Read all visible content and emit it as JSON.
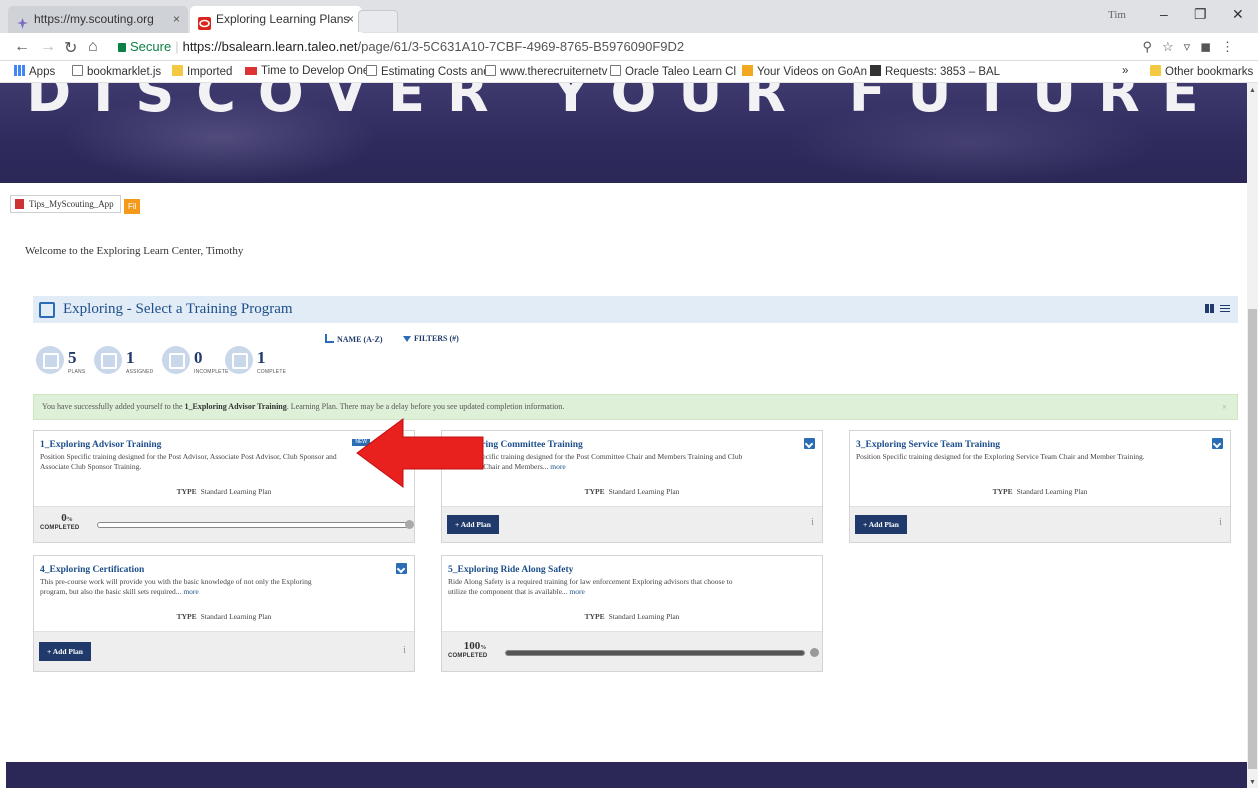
{
  "browser": {
    "tabs": [
      {
        "label": "https://my.scouting.org",
        "close": "×"
      },
      {
        "label": "Exploring Learning Plans",
        "close": "×"
      }
    ],
    "profile": "Tim",
    "url_secure": "Secure",
    "url_base": "https://bsalearn.learn.taleo.net",
    "url_path": "/page/61/3-5C631A10-7CBF-4969-8765-B5976090F9D2",
    "bookmarks": [
      "Apps",
      "bookmarklet.js",
      "Imported",
      "Time to Develop One",
      "Estimating Costs and",
      "www.therecruiternetv",
      "Oracle Taleo Learn Cl",
      "Your Videos on GoAn",
      "Requests: 3853 – BAL",
      "»",
      "Other bookmarks"
    ]
  },
  "hero": {
    "title": "DISCOVER YOUR FUTURE"
  },
  "tip_link": "Tips_MyScouting_App",
  "rss_label": "Fil",
  "welcome": "Welcome to the Exploring Learn Center, Timothy",
  "panel": {
    "title": "Exploring - Select a Training Program"
  },
  "sortbar": {
    "sort": "NAME (A-Z)",
    "filters": "FILTERS (#)"
  },
  "stats": [
    {
      "value": "5",
      "label": "PLANS"
    },
    {
      "value": "1",
      "label": "ASSIGNED"
    },
    {
      "value": "0",
      "label": "INCOMPLETE"
    },
    {
      "value": "1",
      "label": "COMPLETE"
    }
  ],
  "alert": {
    "pre": "You have successfully added yourself to the ",
    "plan": "1_Exploring Advisor Training",
    "post": ". Learning Plan. There may be a delay before you see updated completion information.",
    "close": "×"
  },
  "cards": [
    {
      "title": "1_Exploring Advisor Training",
      "badge": "NEW",
      "desc": "Position Specific training designed for the Post Advisor, Associate Post Advisor, Club Sponsor and Associate Club Sponsor Training.",
      "more": "",
      "type_key": "TYPE",
      "type_val": "Standard Learning Plan",
      "progress_pct": 0,
      "progress_text": "0",
      "progress_label": "COMPLETED"
    },
    {
      "title": "2_Exploring Committee Training",
      "desc": "Position Specific training designed for the Post Committee Chair and Members Training and Club Committee Chair and Members...",
      "more": "more",
      "type_key": "TYPE",
      "type_val": "Standard Learning Plan",
      "button": "+ Add Plan",
      "info": "i"
    },
    {
      "title": "3_Exploring Service Team Training",
      "desc": "Position Specific training designed for the Exploring Service Team Chair and Member Training.",
      "more": "",
      "type_key": "TYPE",
      "type_val": "Standard Learning Plan",
      "button": "+ Add Plan",
      "info": "i"
    },
    {
      "title": "4_Exploring Certification",
      "desc": "This pre-course work will provide you with the basic knowledge of not only the Exploring program, but also the basic skill sets required...",
      "more": "more",
      "type_key": "TYPE",
      "type_val": "Standard Learning Plan",
      "button": "+ Add Plan",
      "info": "i"
    },
    {
      "title": "5_Exploring Ride Along Safety",
      "desc": "Ride Along Safety is a required training for law enforcement Exploring advisors that choose to utilize the component that is available...",
      "more": "more",
      "type_key": "TYPE",
      "type_val": "Standard Learning Plan",
      "progress_pct": 100,
      "progress_text": "100",
      "progress_label": "COMPLETED"
    }
  ],
  "colors": {
    "brand_navy": "#1f3a6b",
    "hero": "#2e2a5c",
    "alert_bg": "#dff0d8",
    "arrow": "#e8201e"
  }
}
